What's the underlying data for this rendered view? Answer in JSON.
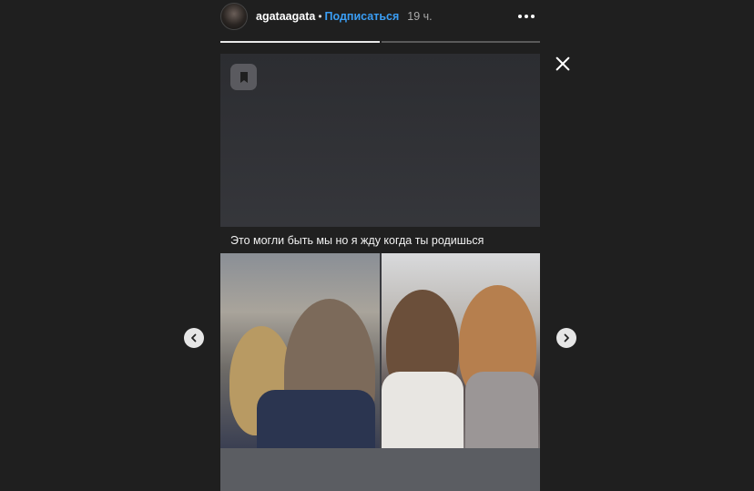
{
  "header": {
    "username": "agataagata",
    "separator": "•",
    "follow_label": "Подписаться",
    "time": "19 ч."
  },
  "progress": {
    "segments_total": 2,
    "current_index": 0
  },
  "story": {
    "caption": "Это могли быть мы но я жду когда ты родишься"
  },
  "icons": {
    "more": "more-options-icon",
    "close": "close-icon",
    "bookmark": "bookmark-icon",
    "prev": "chevron-left-icon",
    "next": "chevron-right-icon"
  }
}
